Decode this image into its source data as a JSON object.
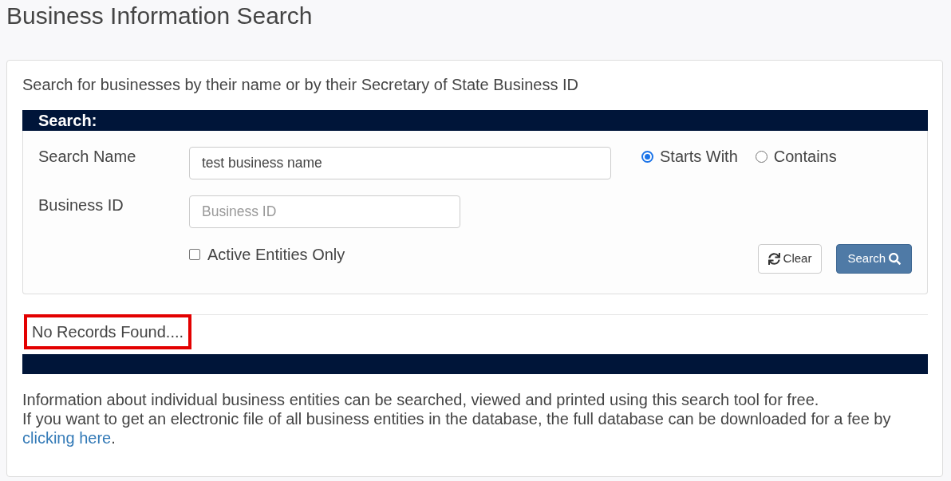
{
  "page": {
    "title": "Business Information Search"
  },
  "intro": "Search for businesses by their name or by their Secretary of State Business ID",
  "search_panel": {
    "heading": "Search:",
    "fields": [
      {
        "kind": "name",
        "label": "Search Name",
        "value": "test business name"
      },
      {
        "kind": "id",
        "label": "Business ID",
        "placeholder": "Business ID"
      }
    ],
    "match_options": [
      {
        "label": "Starts With",
        "selected": true
      },
      {
        "label": "Contains",
        "selected": false
      }
    ],
    "active_only": {
      "label": "Active Entities Only",
      "checked": false
    },
    "buttons": [
      {
        "kind": "clear",
        "label": "Clear"
      },
      {
        "kind": "search",
        "label": "Search"
      }
    ]
  },
  "results": {
    "message": "No Records Found....",
    "highlighted": true
  },
  "footer": {
    "line_1": "Information about individual business entities can be searched, viewed and printed using this search tool for free.",
    "line_2": "If you want to get an electronic file of all business entities in the database, the full database can be downloaded for a fee by",
    "link": "clicking here",
    "line_2_end": "."
  }
}
